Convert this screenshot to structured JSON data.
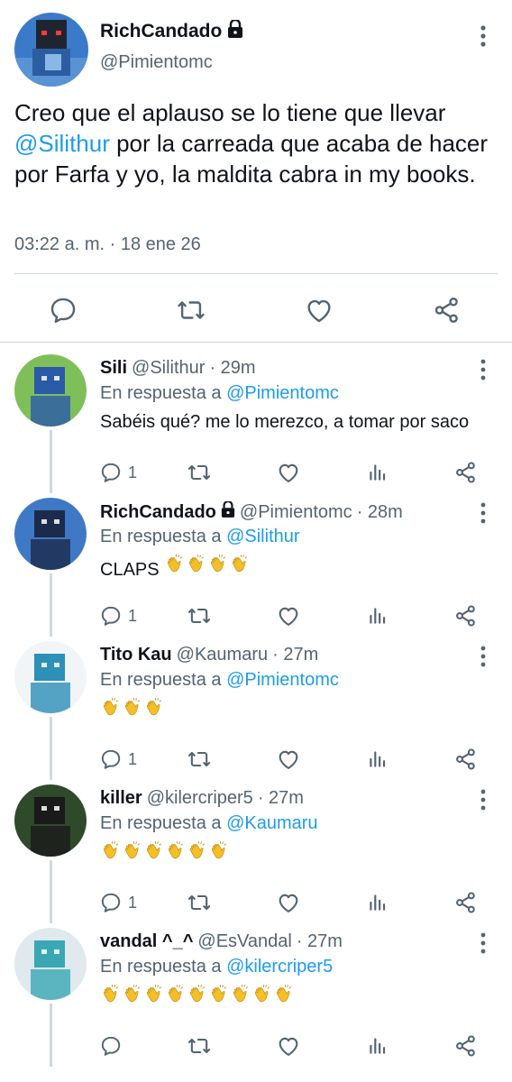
{
  "main_tweet": {
    "name": "RichCandado",
    "handle": "@Pimientomc",
    "text_before": "Creo que el aplauso se lo tiene que llevar ",
    "mention": "@Silithur",
    "text_after": " por la carreada que acaba de hacer por Farfa y yo, la maldita cabra in my books.",
    "timestamp": "03:22 a. m. · 18 ene 26",
    "actions": [
      "reply-icon",
      "retweet-icon",
      "like-icon",
      "share-icon"
    ]
  },
  "replies": [
    {
      "name": "Sili",
      "handle": "@Silithur",
      "time": "· 29m",
      "locked": false,
      "in_reply_label": "En respuesta a",
      "in_reply_to": "@Pimientomc",
      "text": "Sabéis qué? me lo merezco, a tomar por saco",
      "clap_count": 0,
      "reply_count": "1",
      "avatar_colors": [
        "#7fbf5a",
        "#2a5aa8"
      ]
    },
    {
      "name": "RichCandado",
      "handle": "@Pimientomc",
      "time": "· 28m",
      "locked": true,
      "in_reply_label": "En respuesta a",
      "in_reply_to": "@Silithur",
      "text": "CLAPS",
      "clap_count": 4,
      "reply_count": "1",
      "avatar_colors": [
        "#3f79c6",
        "#1c2b4a"
      ]
    },
    {
      "name": "Tito Kau",
      "handle": "@Kaumaru",
      "time": "· 27m",
      "locked": false,
      "in_reply_label": "En respuesta a",
      "in_reply_to": "@Pimientomc",
      "text": "",
      "clap_count": 3,
      "reply_count": "1",
      "avatar_colors": [
        "#f1f5f8",
        "#2e8fb7"
      ]
    },
    {
      "name": "killer",
      "handle": "@kilercriper5",
      "time": "· 27m",
      "locked": false,
      "in_reply_label": "En respuesta a",
      "in_reply_to": "@Kaumaru",
      "text": "",
      "clap_count": 6,
      "reply_count": "1",
      "avatar_colors": [
        "#2f4a2a",
        "#1a1a1a"
      ]
    },
    {
      "name": "vandal ^_^",
      "handle": "@EsVandal",
      "time": "· 27m",
      "locked": false,
      "in_reply_label": "En respuesta a",
      "in_reply_to": "@kilercriper5",
      "text": "",
      "clap_count": 9,
      "reply_count": "",
      "avatar_colors": [
        "#dfe9ee",
        "#3aa7b5"
      ]
    }
  ],
  "colors": {
    "link": "#1d9bf0",
    "muted": "#536471",
    "divider": "#cfd9de",
    "clap": "#f4c028"
  }
}
